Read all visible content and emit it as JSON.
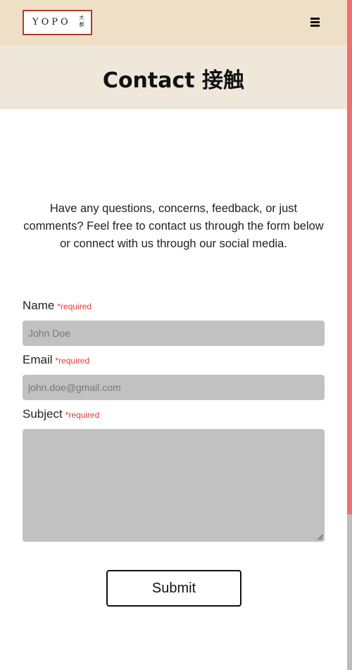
{
  "header": {
    "logo": {
      "word": "YOPO",
      "mark": "大\n都"
    },
    "menu_icon": "hamburger-icon"
  },
  "title": "Contact 接触",
  "intro": "Have any questions, concerns, feedback, or just comments? Feel free to contact us through the form below or connect with us through our social media.",
  "form": {
    "required_label": "*required",
    "name": {
      "label": "Name",
      "placeholder": "John Doe"
    },
    "email": {
      "label": "Email",
      "placeholder": "john.doe@gmail.com"
    },
    "subject": {
      "label": "Subject"
    },
    "submit": "Submit"
  },
  "colors": {
    "header_bg": "#ede0c6",
    "title_bg": "#efe7da",
    "required": "#e53935",
    "field_bg": "#c1c1c1",
    "logo_border": "#b03a2e",
    "scroll_thumb": "#f07070"
  }
}
